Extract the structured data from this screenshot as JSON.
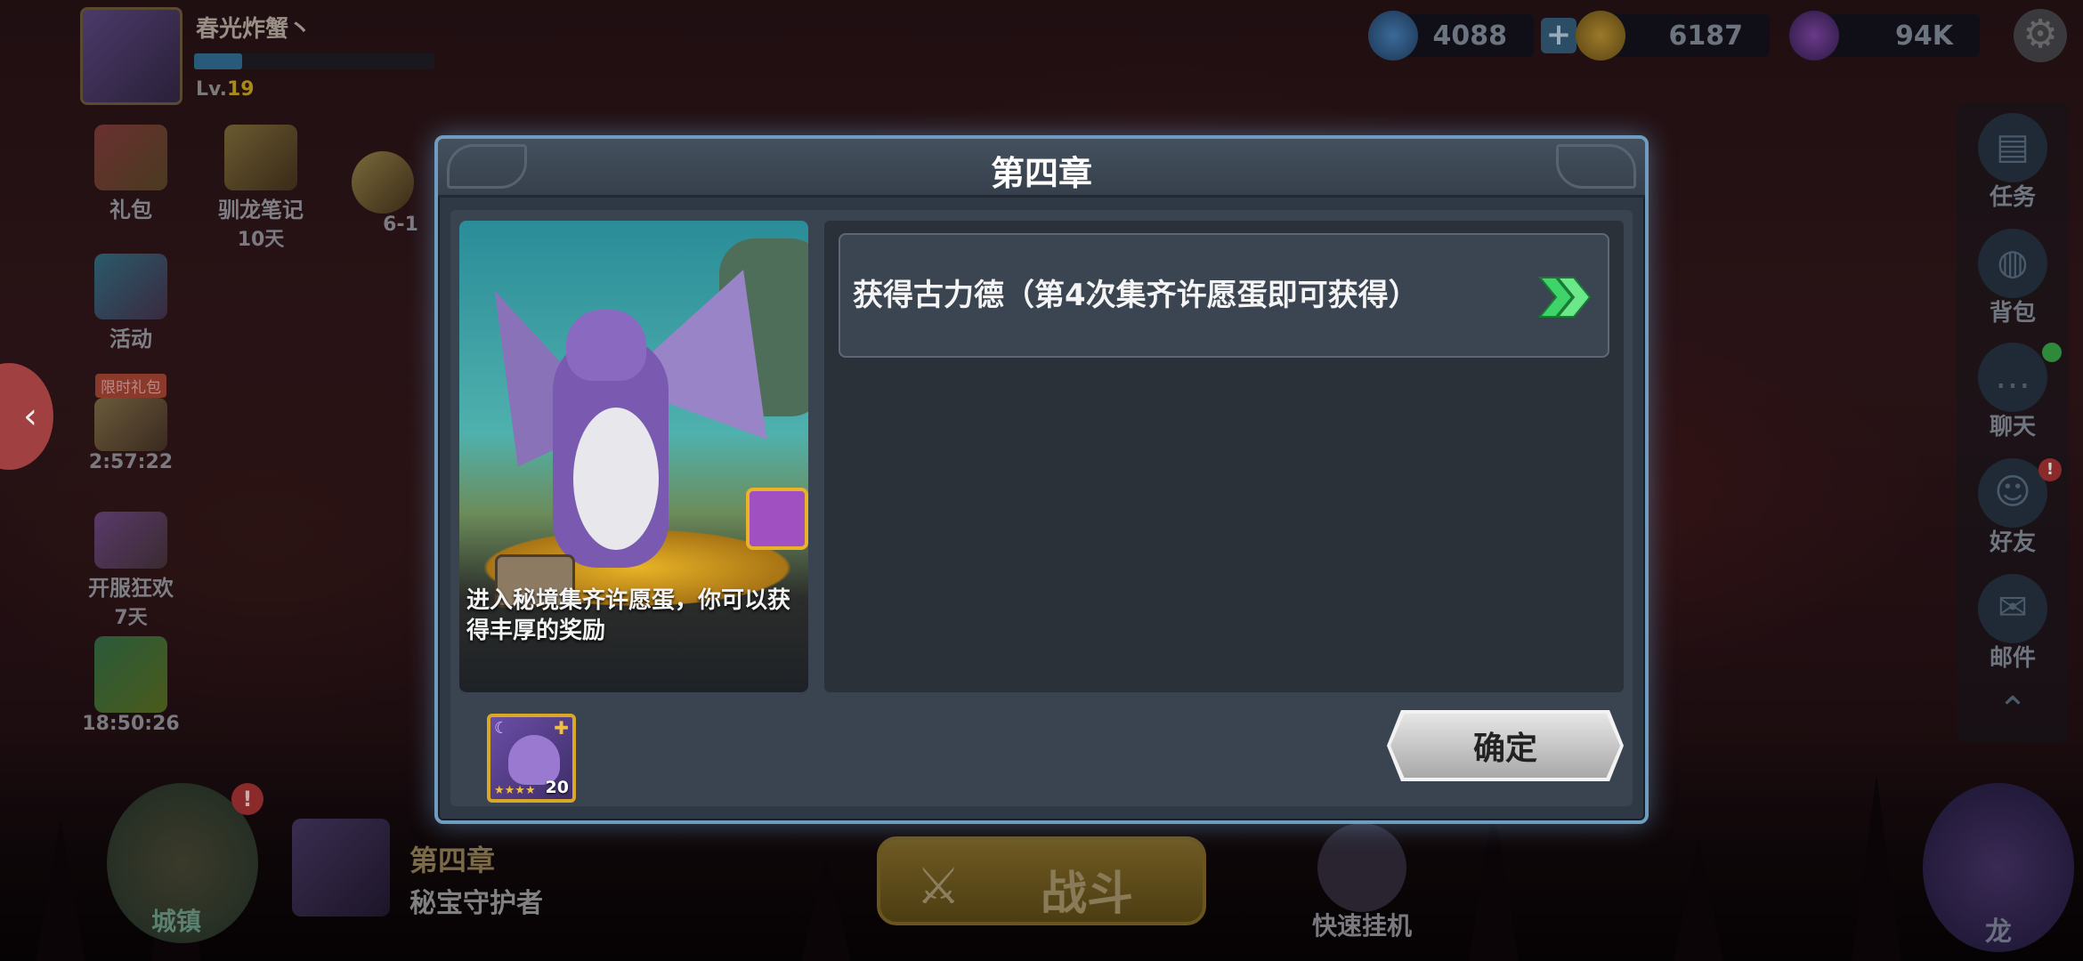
{
  "player": {
    "name": "春光炸蟹丶",
    "level_prefix": "Lv.",
    "level": "19"
  },
  "resources": {
    "gems": "4088",
    "gold": "6187",
    "power": "94K"
  },
  "left_menu": {
    "gift": "礼包",
    "dragon_notes": "驯龙笔记",
    "dragon_notes_days": "10天",
    "activity": "活动",
    "limited_tag": "限时礼包",
    "limited_timer": "2:57:22",
    "carnival": "开服狂欢",
    "carnival_days": "7天",
    "gift_timer": "18:50:26",
    "stage_label": "6-1"
  },
  "right_menu": {
    "quests": "任务",
    "bag": "背包",
    "chat": "聊天",
    "friends": "好友",
    "friends_alert": "!",
    "mail": "邮件"
  },
  "bottom": {
    "town": "城镇",
    "town_alert": "!",
    "chapter_title": "第四章",
    "chapter_subtitle": "秘宝守护者",
    "battle": "战斗",
    "quick_idle": "快速挂机",
    "dragon": "龙"
  },
  "modal": {
    "title": "第四章",
    "art_caption": "进入秘境集齐许愿蛋，你可以获得丰厚的奖励",
    "reward_text": "获得古力德（第4次集齐许愿蛋即可获得）",
    "hero_level": "20",
    "hero_stars": "★★★★",
    "confirm": "确定"
  },
  "colors": {
    "modal_border": "#6e9dbf",
    "arrow_green": "#3fd46a",
    "hero_frame": "#d9a826"
  }
}
